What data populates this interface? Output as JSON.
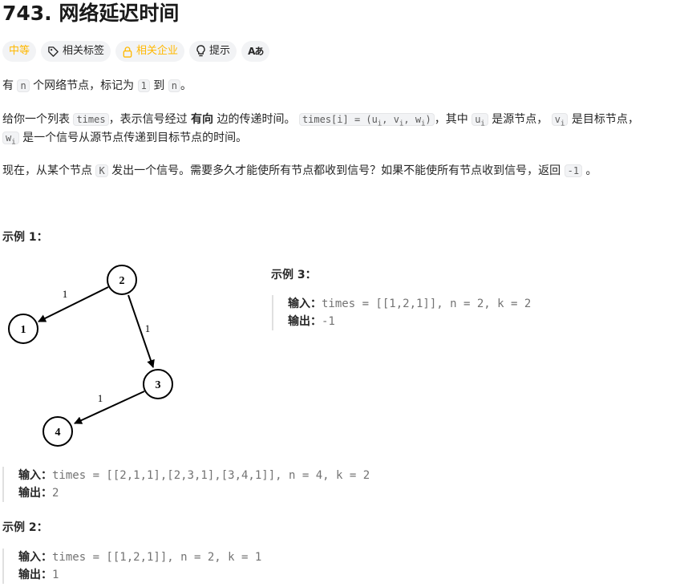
{
  "title": "743. 网络延迟时间",
  "tags": {
    "difficulty": "中等",
    "topics": "相关标签",
    "companies": "相关企业",
    "hint": "提示",
    "lang_icon": "Aあ"
  },
  "desc": {
    "l1_a": "有",
    "l1_n": "n",
    "l1_b": "个网络节点，标记为",
    "l1_one": "1",
    "l1_c": "到",
    "l1_n2": "n",
    "l1_d": "。",
    "l2_a": "给你一个列表",
    "l2_times": "times",
    "l2_b": "，表示信号经过",
    "l2_bold": "有向",
    "l2_c": "边的传递时间。",
    "l2_code_a": "times[i] = (u",
    "l2_code_sub1": "i",
    "l2_code_b": ", v",
    "l2_code_sub2": "i",
    "l2_code_c": ", w",
    "l2_code_sub3": "i",
    "l2_code_d": ")",
    "l2_d": "，其中",
    "l2_u": "u",
    "l2_u_sub": "i",
    "l2_e": "是源节点，",
    "l2_v": "v",
    "l2_v_sub": "i",
    "l2_f": "是目标节点，",
    "l3_w": "w",
    "l3_w_sub": "i",
    "l3_a": "是一个信号从源节点传递到目标节点的时间。",
    "l4_a": "现在，从某个节点",
    "l4_k": "K",
    "l4_b": "发出一个信号。需要多久才能使所有节点都收到信号？如果不能使所有节点收到信号，返回",
    "l4_neg": "-1",
    "l4_c": "。"
  },
  "examples": {
    "ex1_title": "示例 1：",
    "ex1_input_label": "输入：",
    "ex1_input": "times = [[2,1,1],[2,3,1],[3,4,1]], n = 4, k = 2",
    "ex1_output_label": "输出：",
    "ex1_output": "2",
    "ex2_title": "示例 2：",
    "ex2_input_label": "输入：",
    "ex2_input": "times = [[1,2,1]], n = 2, k = 1",
    "ex2_output_label": "输出：",
    "ex2_output": "1",
    "ex3_title": "示例 3：",
    "ex3_input_label": "输入：",
    "ex3_input": "times = [[1,2,1]], n = 2, k = 2",
    "ex3_output_label": "输出：",
    "ex3_output": "-1"
  },
  "graph": {
    "nodes": [
      "2",
      "1",
      "3",
      "4"
    ],
    "edge_weights": [
      "1",
      "1",
      "1"
    ]
  },
  "colors": {
    "difficulty_medium": "#ffb800",
    "code_bg": "#f2f3f5",
    "tag_bg": "#f2f3f5"
  }
}
